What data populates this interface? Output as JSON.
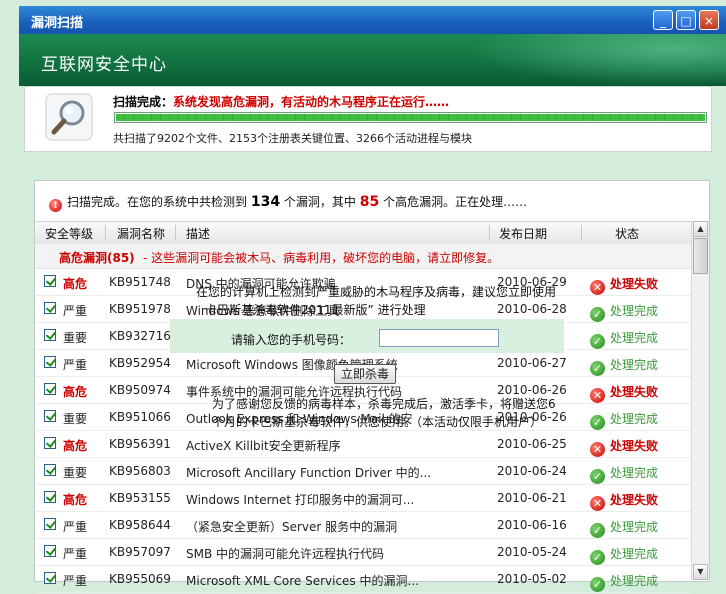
{
  "window": {
    "title": "漏洞扫描",
    "brand": "互联网安全中心",
    "controls": [
      "_",
      "□",
      "×"
    ]
  },
  "scan": {
    "status_label": "扫描完成：",
    "status_text": "系统发现高危漏洞，有活动的木马程序正在运行……",
    "progress": 1.0,
    "summary": "共扫描了9202个文件、2153个注册表关键位置、3266个活动进程与模块"
  },
  "panel": {
    "head_prefix": "扫描完成。在您的系统中共检测到",
    "total": "134",
    "head_mid1": "个漏洞，其中",
    "high": "85",
    "head_mid2": "个高危漏洞。正在处理……",
    "columns": [
      "安全等级",
      "漏洞名称",
      "描述",
      "发布日期",
      "状态"
    ],
    "group_label": "高危漏洞(85)",
    "group_note": "- 这些漏洞可能会被木马、病毒利用，破坏您的电脑，请立即修复。",
    "rows": [
      {
        "level": "高危",
        "kb": "KB951748",
        "desc": "DNS 中的漏洞可能允许欺骗",
        "date": "2010-06-29",
        "status": "处理失败",
        "high": true,
        "ok": false
      },
      {
        "level": "严重",
        "kb": "KB951978",
        "desc": "Windows 恶意软件删除工具",
        "date": "2010-06-28",
        "status": "处理完成",
        "high": false,
        "ok": true
      },
      {
        "level": "重要",
        "kb": "KB932716",
        "desc": "",
        "date": "",
        "status": "处理完成",
        "high": false,
        "ok": true
      },
      {
        "level": "严重",
        "kb": "KB952954",
        "desc": "Microsoft Windows 图像颜色管理系统",
        "date": "2010-06-27",
        "status": "处理完成",
        "high": false,
        "ok": true
      },
      {
        "level": "高危",
        "kb": "KB950974",
        "desc": "事件系统中的漏洞可能允许远程执行代码",
        "date": "2010-06-26",
        "status": "处理失败",
        "high": true,
        "ok": false
      },
      {
        "level": "重要",
        "kb": "KB951066",
        "desc": "Outlook Express 和 Windows Mail 的安",
        "date": "2010-06-26",
        "status": "处理完成",
        "high": false,
        "ok": true
      },
      {
        "level": "高危",
        "kb": "KB956391",
        "desc": "ActiveX Killbit安全更新程序",
        "date": "2010-06-25",
        "status": "处理失败",
        "high": true,
        "ok": false
      },
      {
        "level": "重要",
        "kb": "KB956803",
        "desc": "Microsoft Ancillary Function Driver 中的...",
        "date": "2010-06-24",
        "status": "处理完成",
        "high": false,
        "ok": true
      },
      {
        "level": "高危",
        "kb": "KB953155",
        "desc": "Windows Internet 打印服务中的漏洞可...",
        "date": "2010-06-21",
        "status": "处理失败",
        "high": true,
        "ok": false
      },
      {
        "level": "严重",
        "kb": "KB958644",
        "desc": "（紧急安全更新）Server 服务中的漏洞",
        "date": "2010-06-16",
        "status": "处理完成",
        "high": false,
        "ok": true
      },
      {
        "level": "严重",
        "kb": "KB957097",
        "desc": "SMB 中的漏洞可能允许远程执行代码",
        "date": "2010-05-24",
        "status": "处理完成",
        "high": false,
        "ok": true
      },
      {
        "level": "严重",
        "kb": "KB955069",
        "desc": "Microsoft XML Core Services 中的漏洞...",
        "date": "2010-05-02",
        "status": "处理完成",
        "high": false,
        "ok": true
      }
    ]
  },
  "overlay": {
    "line1": "在您的计算机上检测到严重威胁的木马程序及病毒，建议您立即使用",
    "line2": "卡巴斯基杀毒软件2011最新版” 进行处理",
    "phone_label": "请输入您的手机号码：",
    "phone_value": "",
    "button": "立即杀毒",
    "line3": "为了感谢您反馈的病毒样本，杀毒完成后，激活季卡，将赠送您6",
    "line4": "个月的卡巴斯基杀毒软件，供您使用。（本活动仅限手机用户）"
  },
  "icons": {
    "magnifier": "magnifier-icon",
    "ok": "check-circle-icon",
    "fail": "x-circle-icon",
    "alert": "alert-icon"
  },
  "colors": {
    "accent_green": "#0e6a3c",
    "danger": "#cc0000",
    "ok": "#3a9a3a",
    "titlebar": "#1a5fbd"
  }
}
